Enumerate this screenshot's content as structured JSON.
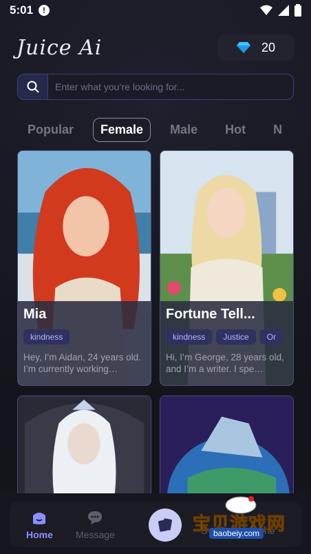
{
  "status_bar": {
    "time": "5:01"
  },
  "header": {
    "logo": "Juice Ai",
    "gems": "20"
  },
  "search": {
    "placeholder": "Enter what you’re looking for..."
  },
  "tabs": [
    {
      "label": "Popular",
      "active": false
    },
    {
      "label": "Female",
      "active": true
    },
    {
      "label": "Male",
      "active": false
    },
    {
      "label": "Hot",
      "active": false
    },
    {
      "label": "N",
      "active": false
    }
  ],
  "cards": [
    {
      "name": "Mia",
      "tags": [
        "kindness"
      ],
      "desc": "Hey, I’m Aidan, 24 years old. I’m currently working…"
    },
    {
      "name": "Fortune Tell...",
      "tags": [
        "kindness",
        "Justice",
        "Or"
      ],
      "desc": "Hi, I’m George, 28 years old, and I’m a writer. I spe…"
    }
  ],
  "nav": {
    "home": "Home",
    "message": "Message",
    "partial": "S",
    "partial_end": "ne"
  },
  "watermark": {
    "text": "宝贝游戏网",
    "url": "baobeiy.com"
  }
}
